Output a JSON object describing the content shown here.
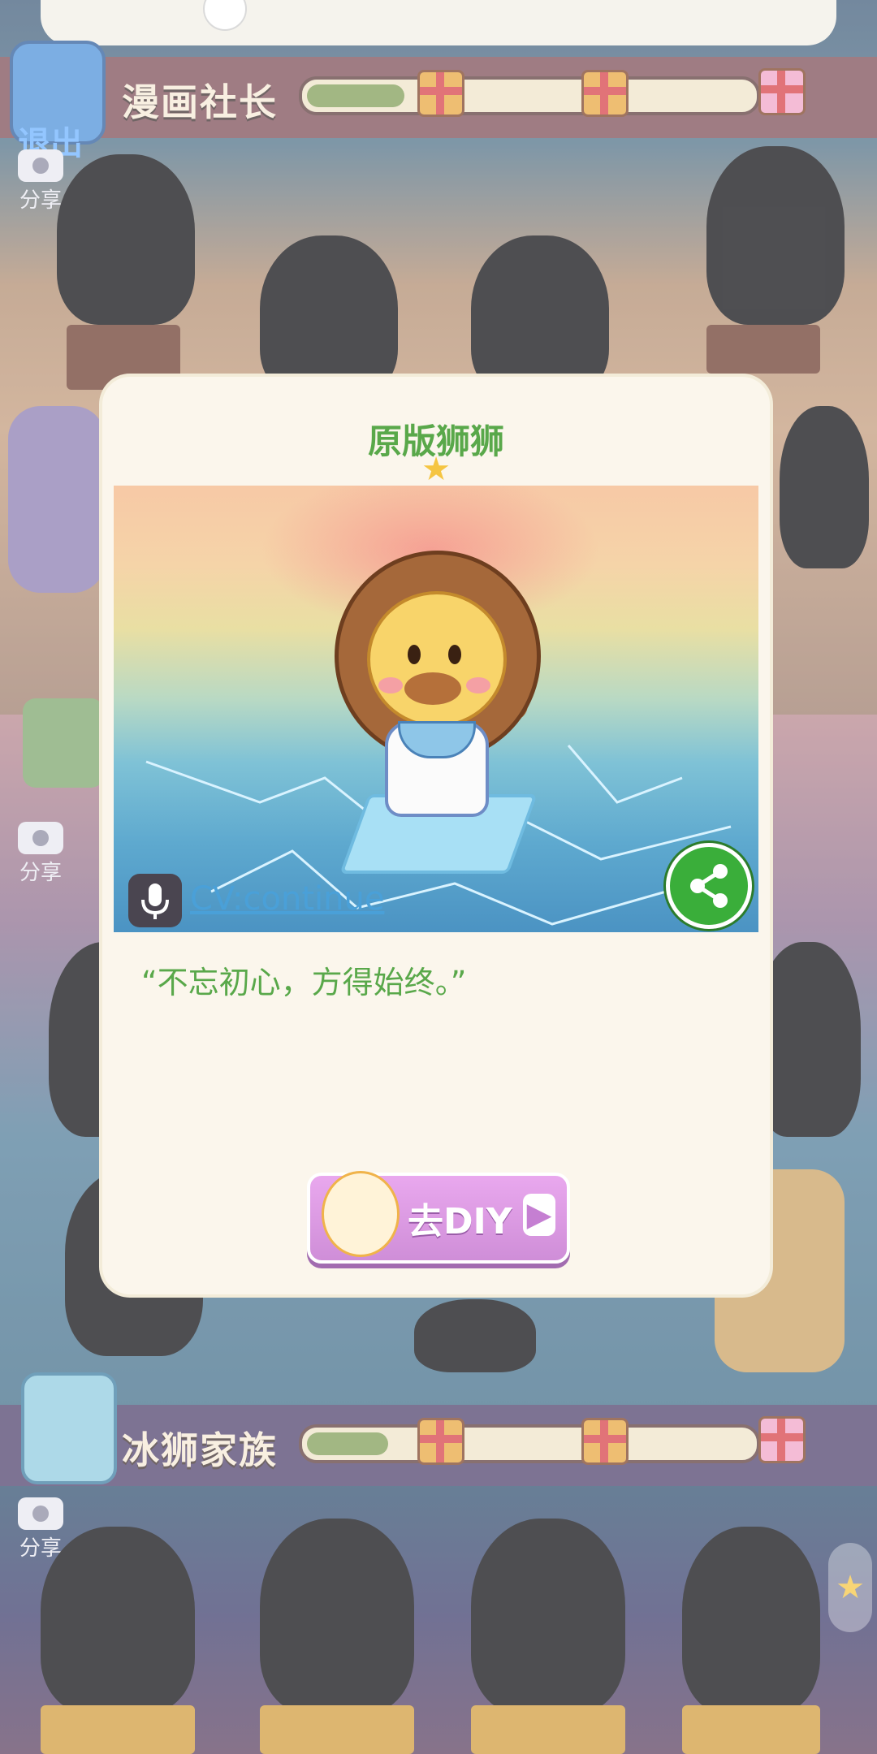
{
  "header": {
    "exit_label": "退出"
  },
  "rows": [
    {
      "title": "漫画社长",
      "progress_fraction": 0.3
    },
    {
      "title": "冰狮家族",
      "progress_fraction": 0.25
    }
  ],
  "share_label": "分享",
  "icons": {
    "gift": "gift-box-icon",
    "camera": "camera-icon",
    "mic": "microphone-icon",
    "share": "share-icon",
    "arrow": "play-arrow-icon",
    "star": "star-icon"
  },
  "modal": {
    "title": "原版狮狮",
    "cv_label": "CV:continue",
    "quote": "“不忘初心，方得始终。”",
    "diy_label": "去DIY"
  },
  "colors": {
    "accent_green": "#59a84a",
    "share_green": "#3aae3a",
    "diy_purple": "#cf8ed8"
  }
}
